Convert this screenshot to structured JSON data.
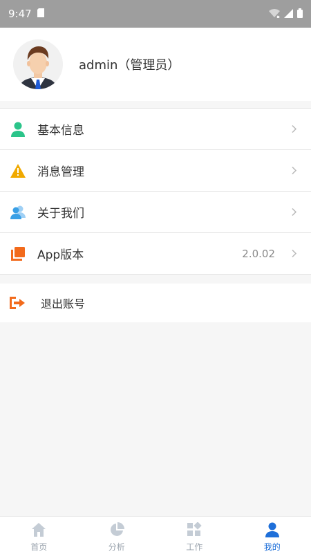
{
  "status_bar": {
    "time": "9:47",
    "icons": [
      "sd-card-icon",
      "wifi-icon",
      "signal-icon",
      "battery-icon"
    ]
  },
  "profile": {
    "username": "admin（管理员）",
    "avatar": "avatar-businessman"
  },
  "menu": {
    "items": [
      {
        "label": "基本信息",
        "icon": "user-icon",
        "color": "#2bc48a"
      },
      {
        "label": "消息管理",
        "icon": "warning-icon",
        "color": "#f0a900"
      },
      {
        "label": "关于我们",
        "icon": "users-icon",
        "color": "#3aa0e6"
      },
      {
        "label": "App版本",
        "icon": "copy-icon",
        "color": "#f26a1b",
        "value": "2.0.02"
      }
    ]
  },
  "logout": {
    "label": "退出账号",
    "icon": "logout-icon",
    "color": "#f26a1b"
  },
  "tabbar": {
    "tabs": [
      {
        "label": "首页",
        "icon": "home-icon"
      },
      {
        "label": "分析",
        "icon": "pie-chart-icon"
      },
      {
        "label": "工作",
        "icon": "apps-icon"
      },
      {
        "label": "我的",
        "icon": "user-icon",
        "active": true
      }
    ],
    "active_color": "#1e6fd9",
    "inactive_color": "#c4ccd5"
  }
}
